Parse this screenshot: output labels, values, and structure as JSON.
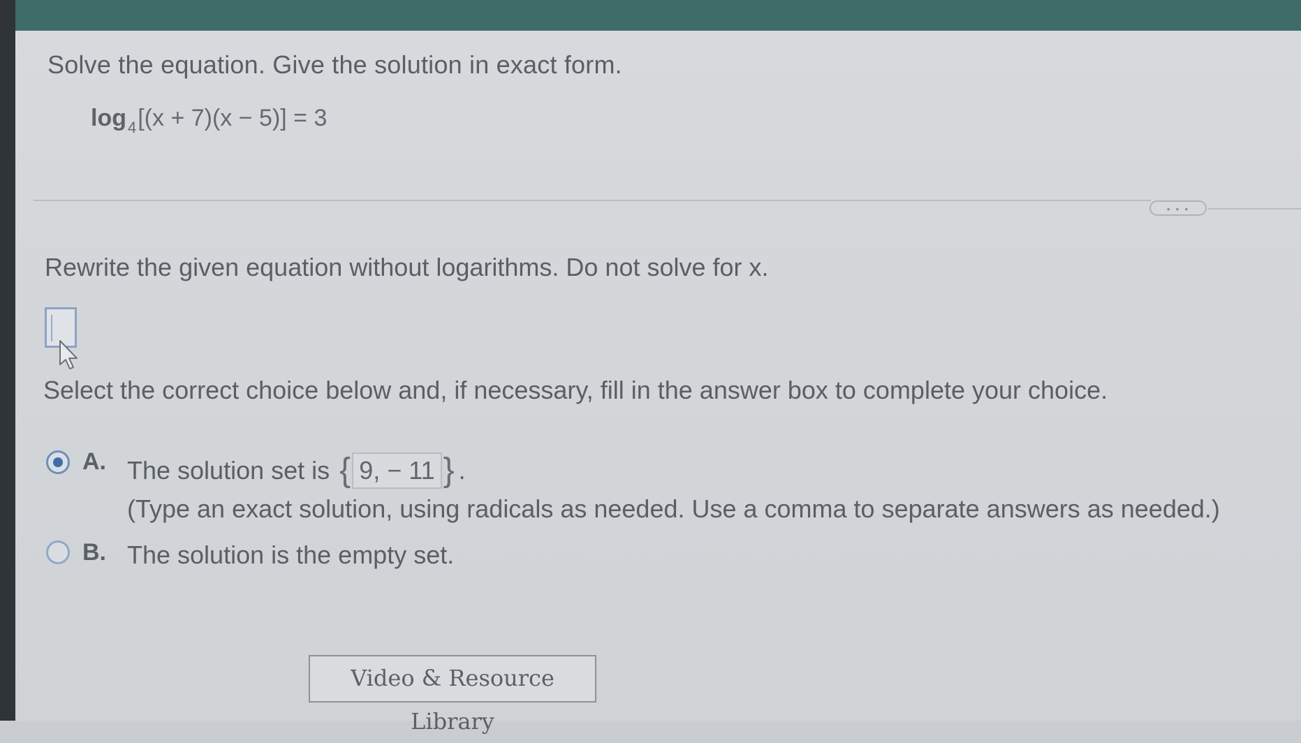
{
  "question": {
    "title": "Solve the equation. Give the solution in exact form.",
    "equation": {
      "func": "log",
      "base": "4",
      "argument": "[(x + 7)(x − 5)] = 3"
    }
  },
  "toolbar": {
    "more_label": "• • •"
  },
  "step": {
    "instruction": "Rewrite the given equation without logarithms. Do not solve for x.",
    "answer_value": ""
  },
  "choices": {
    "prompt": "Select the correct choice below and, if necessary, fill in the answer box to complete your choice.",
    "selected": "A",
    "a": {
      "letter": "A.",
      "text": "The solution set is",
      "open_brace": "{",
      "value": "9, − 11",
      "close_brace": "}",
      "period": ".",
      "hint": "(Type an exact solution, using radicals as needed. Use a comma to separate answers as needed.)"
    },
    "b": {
      "letter": "B.",
      "text": "The solution is the empty set."
    }
  },
  "footer": {
    "video_button_label": "Video & Resource Library"
  },
  "colors": {
    "header": "#3f6b68",
    "radio_selected": "#3f6ea8"
  }
}
